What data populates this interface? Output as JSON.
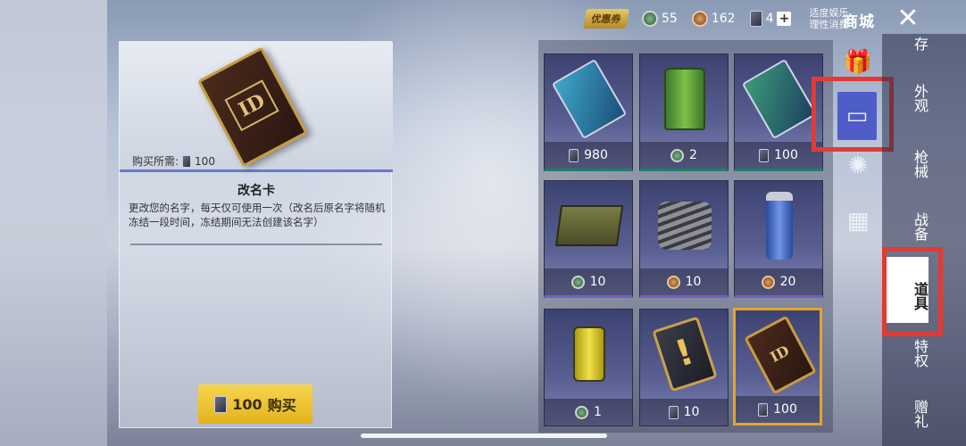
{
  "topbar": {
    "coupon": "优惠券",
    "currency1": "55",
    "currency2": "162",
    "currency3": "4",
    "slogan_line1": "适度娱乐",
    "slogan_line2": "理性消费",
    "shop_title": "商城",
    "close": "✕"
  },
  "detail": {
    "need_label": "购买所需:",
    "need_amount": "100",
    "item_name": "改名卡",
    "item_desc": "更改您的名字，每天仅可使用一次（改名后原名字将随机冻结一段时间，冻结期间无法创建该名字）",
    "buy_amount": "100",
    "buy_label": "购买",
    "card_text": "ID"
  },
  "grid": [
    {
      "price": "980",
      "currency": "card"
    },
    {
      "price": "2",
      "currency": "green"
    },
    {
      "price": "100",
      "currency": "card"
    },
    {
      "price": "10",
      "currency": "green"
    },
    {
      "price": "10",
      "currency": "bronze"
    },
    {
      "price": "20",
      "currency": "bronze"
    },
    {
      "price": "1",
      "currency": "green"
    },
    {
      "price": "10",
      "currency": "card"
    },
    {
      "price": "100",
      "currency": "card"
    }
  ],
  "nav": {
    "storage": "存",
    "appearance": "外观",
    "weapons": "枪械",
    "battle": "战备",
    "items": "道具",
    "privilege": "特权",
    "gift": "赠礼"
  },
  "icons": {
    "gift": "gift-icon",
    "box": "box-icon",
    "fireworks": "fireworks-icon",
    "crate": "crate-icon"
  },
  "colors": {
    "accent": "#4e5dc7",
    "highlight": "#e23a34",
    "buy": "#f6d64e"
  }
}
